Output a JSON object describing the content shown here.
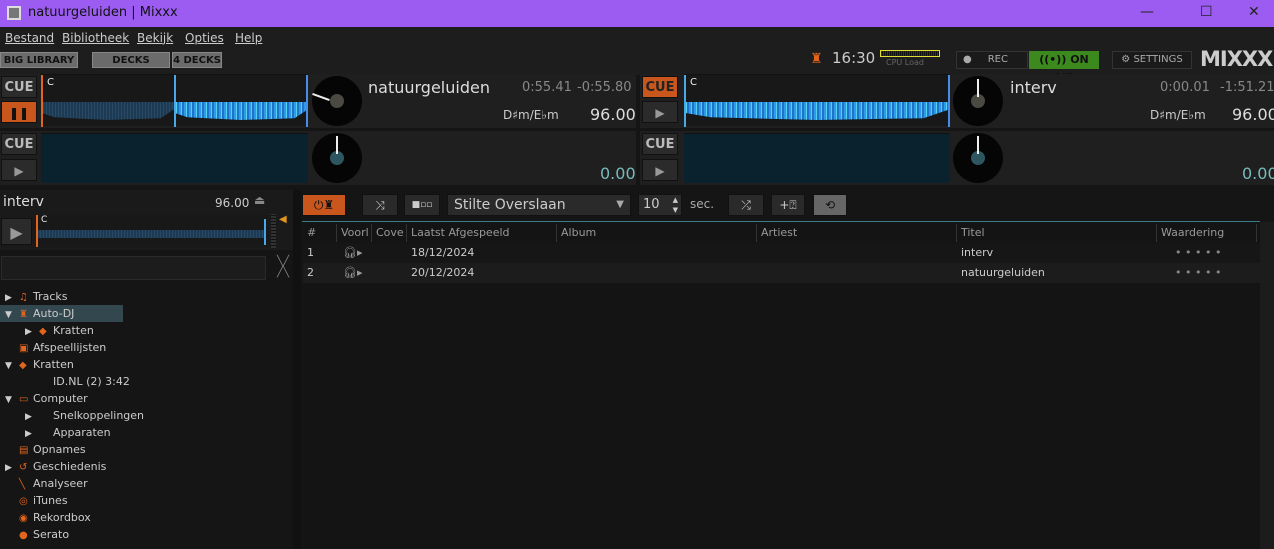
{
  "window": {
    "title": "natuurgeluiden | Mixxx",
    "minimize": "—",
    "maximize": "☐",
    "close": "✕"
  },
  "menu": [
    "Bestand",
    "Bibliotheek",
    "Bekijk",
    "Opties",
    "Help"
  ],
  "toolbar": {
    "big_library": "BIG LIBRARY",
    "decks": "DECKS",
    "four_decks": "4 DECKS",
    "clock": "16:30",
    "cpu_label": "CPU Load",
    "rec": "REC",
    "on_air": "ON AIR",
    "settings": "SETTINGS",
    "logo": "MIXXX"
  },
  "decks": [
    {
      "cue": "CUE",
      "title": "natuurgeluiden",
      "elapsed": "0:55.41",
      "remaining": "-0:55.80",
      "key": "D♯m/E♭m",
      "bpm": "96.00",
      "marker": "C",
      "playing": true
    },
    {
      "cue": "CUE",
      "title": "interv",
      "elapsed": "0:00.01",
      "remaining": "-1:51.21",
      "key": "D♯m/E♭m",
      "bpm": "96.00",
      "marker": "C",
      "playing": false
    },
    {
      "cue": "CUE",
      "bpm": "0.00"
    },
    {
      "cue": "CUE",
      "bpm": "0.00"
    }
  ],
  "preview": {
    "title": "interv",
    "bpm": "96.00",
    "marker": "C"
  },
  "sidebar": [
    {
      "label": "Tracks",
      "icon": "music-icon",
      "arrow": "▶",
      "indent": 0
    },
    {
      "label": "Auto-DJ",
      "icon": "robot-icon",
      "arrow": "▼",
      "indent": 0,
      "selected": true
    },
    {
      "label": "Kratten",
      "icon": "crate-icon",
      "arrow": "▶",
      "indent": 1
    },
    {
      "label": "Afspeellijsten",
      "icon": "playlist-icon",
      "arrow": "",
      "indent": 0
    },
    {
      "label": "Kratten",
      "icon": "crate-icon",
      "arrow": "▼",
      "indent": 0
    },
    {
      "label": "ID.NL (2) 3:42",
      "icon": "",
      "arrow": "",
      "indent": 1
    },
    {
      "label": "Computer",
      "icon": "computer-icon",
      "arrow": "▼",
      "indent": 0
    },
    {
      "label": "Snelkoppelingen",
      "icon": "",
      "arrow": "▶",
      "indent": 1
    },
    {
      "label": "Apparaten",
      "icon": "",
      "arrow": "▶",
      "indent": 1
    },
    {
      "label": "Opnames",
      "icon": "recording-icon",
      "arrow": "",
      "indent": 0
    },
    {
      "label": "Geschiedenis",
      "icon": "history-icon",
      "arrow": "▶",
      "indent": 0
    },
    {
      "label": "Analyseer",
      "icon": "analyze-icon",
      "arrow": "",
      "indent": 0
    },
    {
      "label": "iTunes",
      "icon": "itunes-icon",
      "arrow": "",
      "indent": 0
    },
    {
      "label": "Rekordbox",
      "icon": "rekordbox-icon",
      "arrow": "",
      "indent": 0
    },
    {
      "label": "Serato",
      "icon": "serato-icon",
      "arrow": "",
      "indent": 0
    }
  ],
  "autodj": {
    "transition": "Stilte Overslaan",
    "seconds": "10",
    "sec_label": "sec."
  },
  "table": {
    "headers": [
      "#",
      "Voorl",
      "Cove",
      "Laatst Afgespeeld",
      "Album",
      "Artiest",
      "Titel",
      "Waardering"
    ],
    "rows": [
      {
        "n": "1",
        "played": "18/12/2024",
        "title": "interv",
        "rating": "• • • • •"
      },
      {
        "n": "2",
        "played": "20/12/2024",
        "title": "natuurgeluiden",
        "rating": "• • • • •"
      }
    ]
  },
  "colors": {
    "accent": "#c9561c",
    "titlebar": "#9c5cf2",
    "waveform": "#2f9be8",
    "on_air": "#3c8a1e"
  }
}
